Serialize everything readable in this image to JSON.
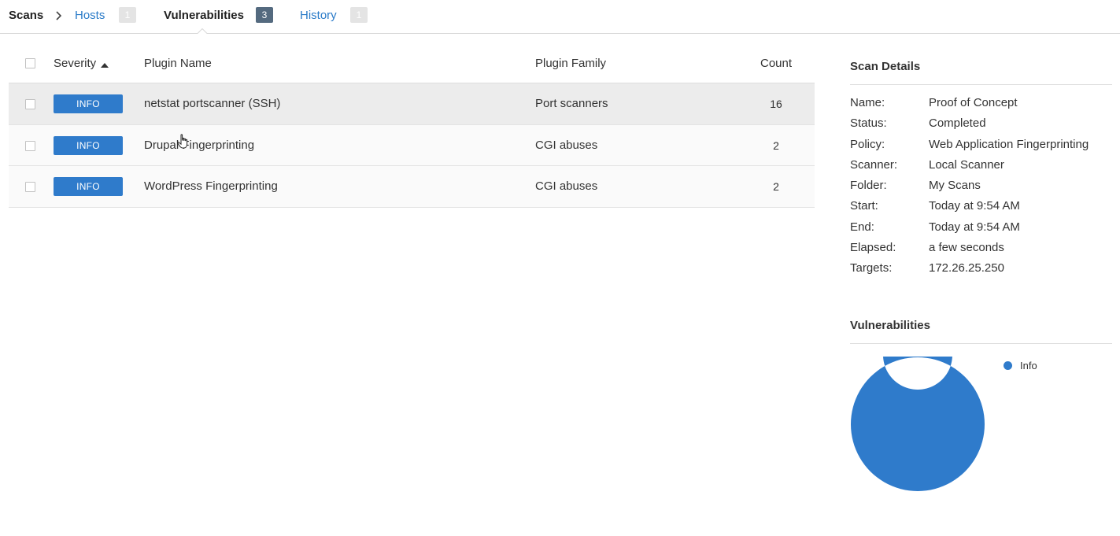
{
  "breadcrumb": {
    "root": "Scans",
    "tabs": [
      {
        "label": "Hosts",
        "count": "1",
        "active": false
      },
      {
        "label": "Vulnerabilities",
        "count": "3",
        "active": true
      },
      {
        "label": "History",
        "count": "1",
        "active": false
      }
    ]
  },
  "table": {
    "columns": {
      "severity": "Severity",
      "plugin_name": "Plugin Name",
      "plugin_family": "Plugin Family",
      "count": "Count"
    },
    "rows": [
      {
        "severity": "INFO",
        "plugin_name": "netstat portscanner (SSH)",
        "plugin_family": "Port scanners",
        "count": "16"
      },
      {
        "severity": "INFO",
        "plugin_name": "Drupal Fingerprinting",
        "plugin_family": "CGI abuses",
        "count": "2"
      },
      {
        "severity": "INFO",
        "plugin_name": "WordPress Fingerprinting",
        "plugin_family": "CGI abuses",
        "count": "2"
      }
    ]
  },
  "scan_details": {
    "title": "Scan Details",
    "fields": [
      {
        "label": "Name:",
        "value": "Proof of Concept"
      },
      {
        "label": "Status:",
        "value": "Completed"
      },
      {
        "label": "Policy:",
        "value": "Web Application Fingerprinting"
      },
      {
        "label": "Scanner:",
        "value": "Local Scanner"
      },
      {
        "label": "Folder:",
        "value": "My Scans"
      },
      {
        "label": "Start:",
        "value": "Today at 9:54 AM"
      },
      {
        "label": "End:",
        "value": "Today at 9:54 AM"
      },
      {
        "label": "Elapsed:",
        "value": "a few seconds"
      },
      {
        "label": "Targets:",
        "value": "172.26.25.250"
      }
    ]
  },
  "vulnerabilities_panel": {
    "title": "Vulnerabilities",
    "legend": [
      {
        "label": "Info",
        "color": "#2f7bcb"
      }
    ]
  },
  "chart_data": {
    "type": "pie",
    "categories": [
      "Info"
    ],
    "values": [
      100
    ],
    "colors": [
      "#2f7bcb"
    ],
    "donut": true,
    "legend_position": "top-right"
  },
  "colors": {
    "accent": "#2f7bcb",
    "link": "#2a7bc8",
    "active_badge": "#546a7f",
    "inactive_badge": "#e4e4e4"
  },
  "icons": {
    "breadcrumb_separator": "chevron-right-icon",
    "sort": "sort-ascending-icon",
    "cursor": "hand-pointer-icon"
  }
}
